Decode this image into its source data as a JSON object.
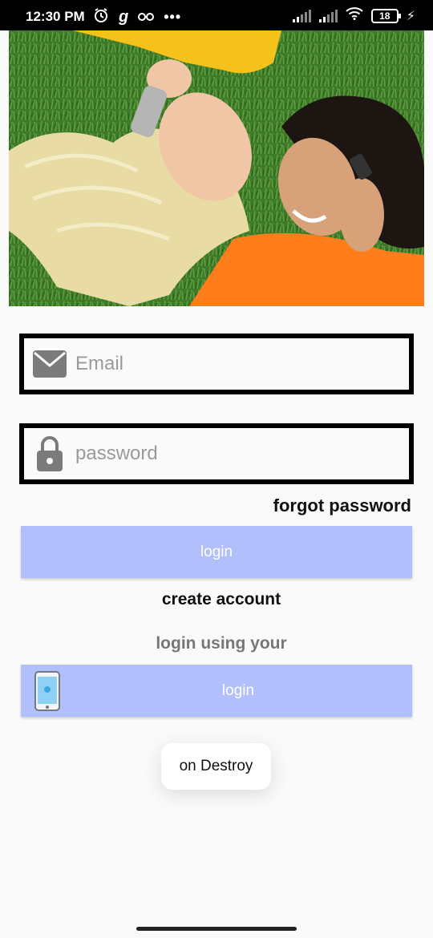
{
  "status_bar": {
    "time": "12:30 PM",
    "icons": [
      "alarm-icon",
      "g-app-icon",
      "glasses-icon",
      "more-dots-icon"
    ],
    "battery": "18"
  },
  "login_form": {
    "email_placeholder": "Email",
    "password_placeholder": "password",
    "forgot_password": "forgot password",
    "login_button": "login",
    "create_account": "create account",
    "login_using": "login using your",
    "phone_login_button": "login"
  },
  "toast": "on Destroy",
  "colors": {
    "button": "#b1c0fc",
    "field_border": "#000000"
  }
}
